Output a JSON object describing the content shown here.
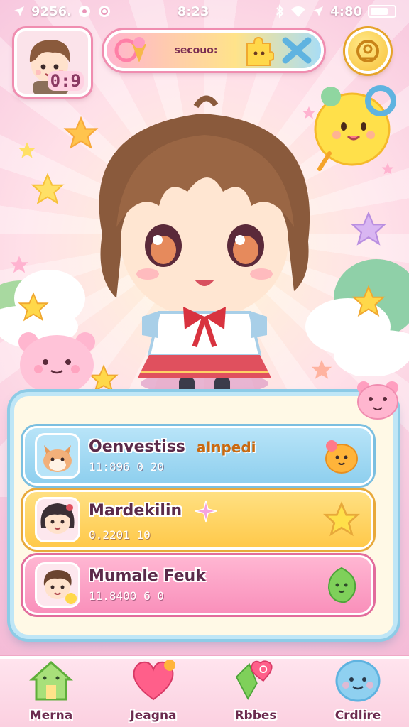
{
  "status_bar": {
    "left_text": "9256.",
    "time": "8:23",
    "battery_text": "4:80",
    "battery_level": 0.75
  },
  "hud": {
    "player_level": "0:9",
    "score_label": "secouo:",
    "avatar_icon": "boy-avatar-icon",
    "coin_icon": "gold-coin-icon"
  },
  "scene": {
    "character_icon": "chibi-girl-icon",
    "pet_icon": "yellow-blob-pet-icon"
  },
  "quests": [
    {
      "title": "Oenvestiss",
      "tag": "alnpedi",
      "sub": "11:896 0 20",
      "portrait_icon": "fox-portrait-icon",
      "reward_icon": "orange-blob-icon",
      "color": "#8ecfee"
    },
    {
      "title": "Mardekilin",
      "tag": "",
      "sub": "0.2201 10",
      "portrait_icon": "dark-hair-girl-icon",
      "reward_icon": "yellow-star-icon",
      "color": "#ffc94a"
    },
    {
      "title": "Mumale Feuk",
      "tag": "",
      "sub": "11.8400 6 0",
      "portrait_icon": "brown-hair-boy-icon",
      "reward_icon": "green-leaf-icon",
      "color": "#f990bb"
    }
  ],
  "nav": [
    {
      "label": "Merna",
      "icon": "house-icon"
    },
    {
      "label": "Jeagna",
      "icon": "heart-icon"
    },
    {
      "label": "Rbbes",
      "icon": "gem-heart-icon"
    },
    {
      "label": "Crdlire",
      "icon": "blue-blob-icon"
    }
  ]
}
